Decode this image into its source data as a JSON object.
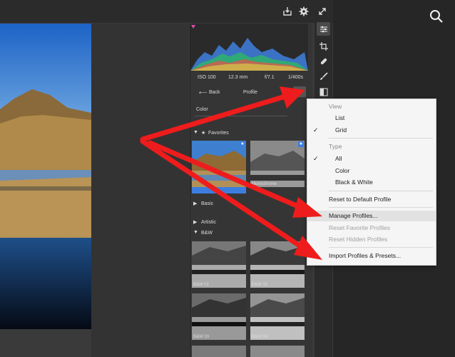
{
  "exif": {
    "iso": "ISO 100",
    "focal": "12.3 mm",
    "aperture": "f/7.1",
    "shutter": "1/400s"
  },
  "profile_header": {
    "back_label": "Back",
    "title": "Profile"
  },
  "profile_select": {
    "value": "Color"
  },
  "favorites": {
    "label": "Favorites",
    "items": [
      {
        "caption": "Color"
      },
      {
        "caption": "Monochrome"
      }
    ]
  },
  "sections": {
    "basic": "Basic",
    "artistic": "Artistic",
    "bw": "B&W"
  },
  "bw_thumbs": [
    {
      "caption": "B&W 01"
    },
    {
      "caption": "B&W 02"
    },
    {
      "caption": "B&W 03"
    },
    {
      "caption": "B&W 04"
    }
  ],
  "menu": {
    "view_header": "View",
    "list": "List",
    "grid": "Grid",
    "type_header": "Type",
    "all": "All",
    "color": "Color",
    "bw": "Black & White",
    "reset_default": "Reset to Default Profile",
    "manage": "Manage Profiles...",
    "reset_favorite": "Reset Favorite Profiles",
    "reset_hidden": "Reset Hidden Profiles",
    "import": "Import Profiles & Presets...",
    "check_glyph": "✓"
  },
  "colors": {
    "annotation_arrow": "#ee1c1c",
    "favorite_selected": "#3d7de0"
  },
  "icons": [
    "export-icon",
    "gear-icon",
    "expand-icon",
    "search-icon",
    "edit-sliders-icon",
    "crop-icon",
    "healing-icon",
    "brush-icon",
    "gradient-icon",
    "more-options-icon"
  ]
}
